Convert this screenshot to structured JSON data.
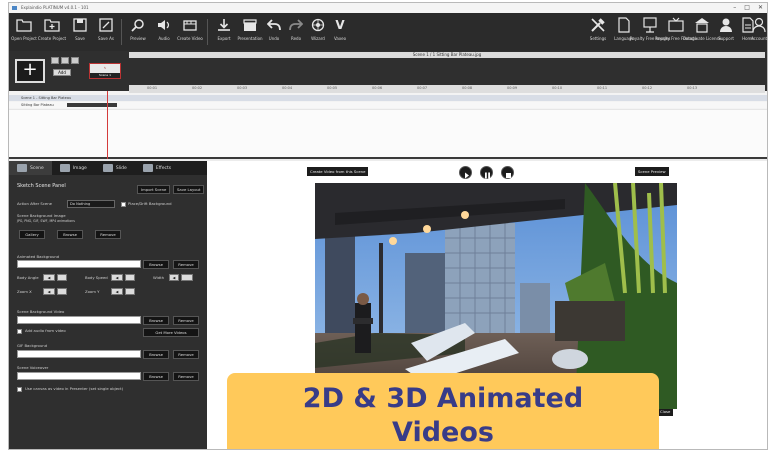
{
  "window": {
    "title": "Explaindio PLATINUM v4.0.1 - 101"
  },
  "toolbar": {
    "left_items": [
      {
        "label": "Open Project",
        "icon": "folder-open-icon"
      },
      {
        "label": "Create Project",
        "icon": "folder-plus-icon"
      },
      {
        "label": "Save",
        "icon": "save-icon"
      },
      {
        "label": "Save As",
        "icon": "save-as-icon"
      },
      {
        "label": "Preview",
        "icon": "search-icon"
      },
      {
        "label": "Audio",
        "icon": "audio-icon"
      },
      {
        "label": "Create Video",
        "icon": "film-icon"
      },
      {
        "label": "Export",
        "icon": "download-icon"
      },
      {
        "label": "Presentation",
        "icon": "clapper-icon"
      },
      {
        "label": "Undo",
        "icon": "undo-icon"
      },
      {
        "label": "Redo",
        "icon": "redo-icon"
      },
      {
        "label": "Wizard",
        "icon": "settings-wheel-icon"
      },
      {
        "label": "Vaxeo",
        "icon": "v-logo-icon"
      }
    ],
    "right_items": [
      {
        "label": "Settings",
        "icon": "tools-icon"
      },
      {
        "label": "Language",
        "icon": "document-icon"
      },
      {
        "label": "Royalty Free Images",
        "icon": "image-board-icon"
      },
      {
        "label": "Royalty Free Footage",
        "icon": "tv-icon"
      },
      {
        "label": "Deactivate License",
        "icon": "building-icon"
      },
      {
        "label": "Support",
        "icon": "user-icon"
      },
      {
        "label": "Home",
        "icon": "page-icon"
      },
      {
        "label": "Account",
        "icon": "account-icon"
      }
    ]
  },
  "timeline": {
    "caption": "Scene 1 / 1   Sitting Bar Plateau.jpg",
    "add_label": "Add",
    "scene_thumb_label": "Scene 1",
    "ruler": [
      "00:00",
      "00:01",
      "00:02",
      "00:03",
      "00:04",
      "00:05",
      "00:06",
      "00:07",
      "00:08",
      "00:09",
      "00:10",
      "00:11",
      "00:12",
      "00:13"
    ],
    "row1_label": "Scene 1 - Sitting Bar Plateau",
    "row2_label": "Sitting Bar Plateau"
  },
  "left_panel": {
    "tabs": [
      "Scene",
      "Image",
      "Slide",
      "Effects"
    ],
    "panel_title": "Sketch Scene Panel",
    "import_scene": "Import Scene",
    "save_layout": "Save Layout",
    "action_after_scene_label": "Action After Scene",
    "action_after_scene_value": "Do Nothing",
    "transparent_bg_label": "Place/Drift Background",
    "scene_bg_image_label": "Scene Background Image",
    "scene_bg_image_hint": "JPG, PNG, GIF, SWF, MP4 animations",
    "gallery": "Gallery",
    "browse": "Browse",
    "remove": "Remove",
    "animated_bg_label": "Animated Background",
    "body_angle_label": "Body Angle",
    "body_speed_label": "Body Speed",
    "width_label": "Width",
    "zoom_x_label": "Zoom X",
    "zoom_y_label": "Zoom Y",
    "scene_bg_video_label": "Scene Background Video",
    "add_audio_label": "Add audio from video",
    "get_more_videos": "Get More Videos",
    "gif_bg_label": "GIF Background",
    "scene_voiceover_label": "Scene Voiceover",
    "use_canvas_label": "Use canvas as video in Presenter (set single object)"
  },
  "preview": {
    "create_video_label": "Create Video from this Scene",
    "scene_preview_label": "Scene Preview",
    "bottom_right_label": "Close"
  },
  "banner": {
    "line1": "2D & 3D Animated",
    "line2": "Videos",
    "color": "#ffc95a",
    "text_color": "#383c88"
  }
}
